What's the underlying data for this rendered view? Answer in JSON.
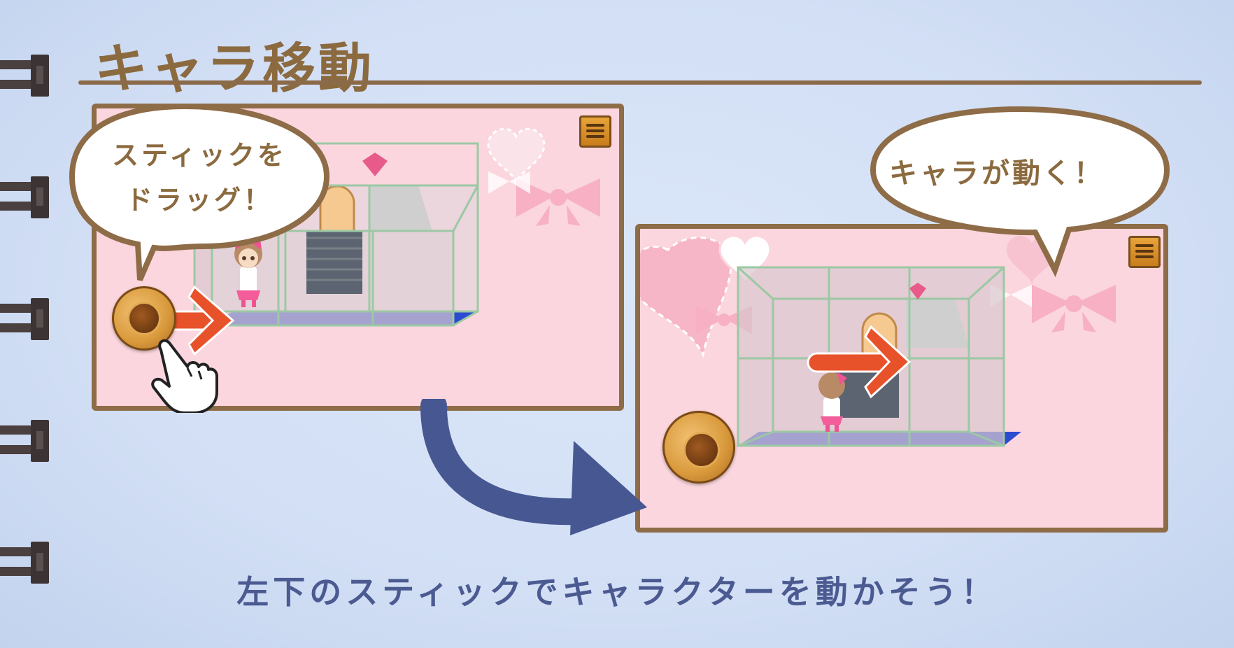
{
  "page": {
    "title": "キャラ移動",
    "caption": "左下のスティックでキャラクターを動かそう！"
  },
  "bubbles": {
    "drag": {
      "line1": "スティックを",
      "line2": "ドラッグ！"
    },
    "moves": "キャラが動く！"
  },
  "colors": {
    "background": "#d2dff5",
    "title": "#8b6a3f",
    "caption": "#4b5a91",
    "frame": "#8e6c47",
    "arrow": "#e8522a",
    "curve_arrow": "#475791",
    "screen_bg": "#fbd6de"
  },
  "icons": {
    "menu": "hamburger-menu-icon",
    "stick": "virtual-joystick-icon",
    "hand": "pointing-hand-icon"
  }
}
